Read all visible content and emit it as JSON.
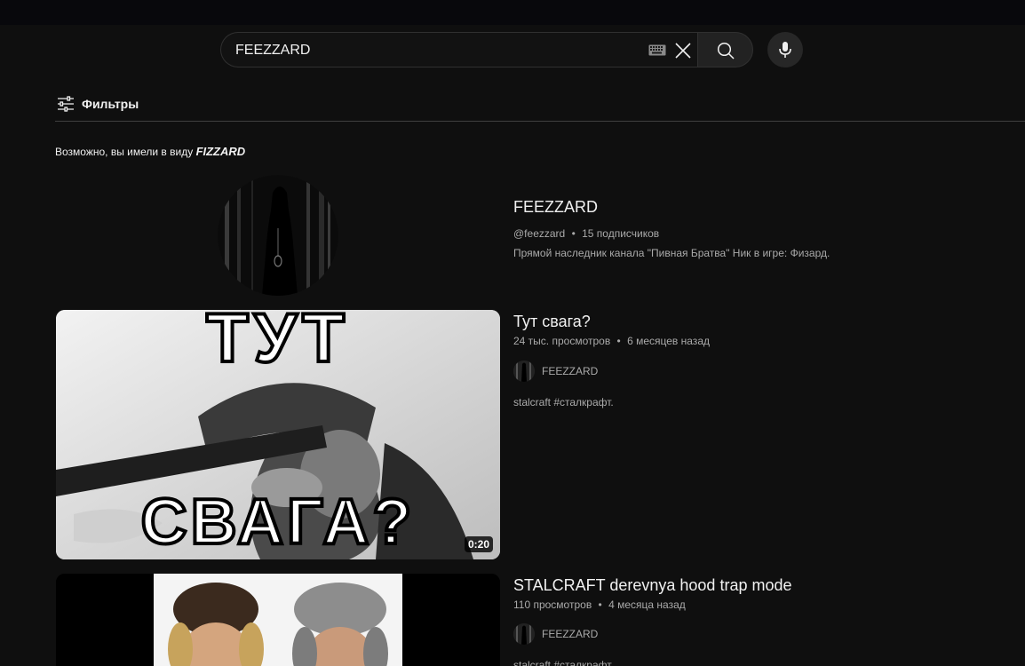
{
  "search": {
    "query": "FEEZZARD",
    "icons": [
      "keyboard-icon",
      "close-icon",
      "search-icon",
      "mic-icon"
    ]
  },
  "filters": {
    "label": "Фильтры"
  },
  "suggestion": {
    "prefix": "Возможно, вы имели в виду ",
    "term": "FIZZARD"
  },
  "channel": {
    "name": "FEEZZARD",
    "handle": "@feezzard",
    "separator": "•",
    "subscribers": "15 подписчиков",
    "description": "Прямой наследник канала \"Пивная Братва\" Ник в игре: Физард."
  },
  "videos": [
    {
      "title": "Тут свага?",
      "views": "24 тыс. просмотров",
      "separator": "•",
      "age": "6 месяцев назад",
      "channel": "FEEZZARD",
      "description": "stalcraft #сталкрафт.",
      "duration": "0:20",
      "thumb_text_top": "ТУТ",
      "thumb_text_bottom": "СВАГА?"
    },
    {
      "title": "STALCRAFT derevnya hood trap mode",
      "views": "110 просмотров",
      "separator": "•",
      "age": "4 месяца назад",
      "channel": "FEEZZARD",
      "description": "stalcraft #сталкрафт."
    }
  ],
  "colors": {
    "background": "#0f0f0f",
    "text_primary": "#f1f1f1",
    "text_secondary": "#aaaaaa"
  }
}
